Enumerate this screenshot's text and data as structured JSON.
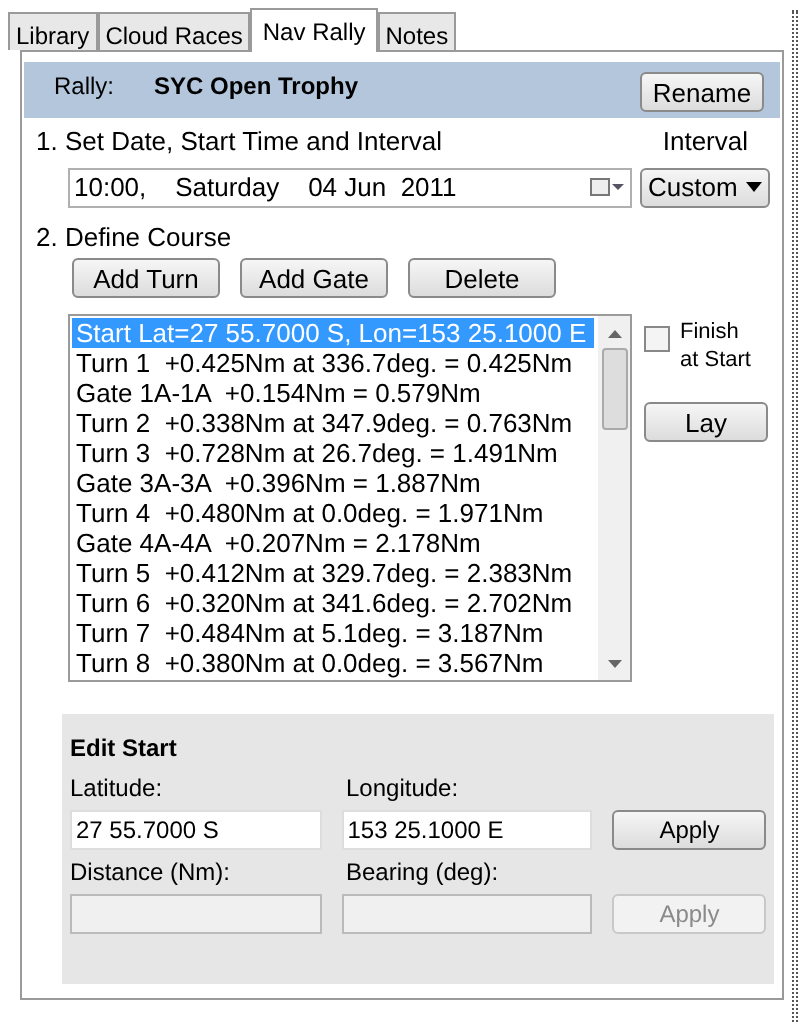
{
  "tabs": [
    {
      "label": "Library",
      "selected": false
    },
    {
      "label": "Cloud Races",
      "selected": false
    },
    {
      "label": "Nav Rally",
      "selected": true
    },
    {
      "label": "Notes",
      "selected": false
    }
  ],
  "rally": {
    "label": "Rally:",
    "name": "SYC Open Trophy",
    "rename_button": "Rename"
  },
  "step1": {
    "label": "1. Set Date, Start Time and Interval",
    "interval_label": "Interval",
    "datetime": "10:00,    Saturday    04 Jun  2011",
    "interval_value": "Custom"
  },
  "step2": {
    "label": "2. Define Course",
    "buttons": [
      "Add Turn",
      "Add Gate",
      "Delete"
    ]
  },
  "course": [
    {
      "text": "Start Lat=27 55.7000 S, Lon=153 25.1000 E",
      "selected": true
    },
    {
      "text": "Turn 1  +0.425Nm at 336.7deg. = 0.425Nm",
      "selected": false
    },
    {
      "text": "Gate 1A-1A  +0.154Nm = 0.579Nm",
      "selected": false
    },
    {
      "text": "Turn 2  +0.338Nm at 347.9deg. = 0.763Nm",
      "selected": false
    },
    {
      "text": "Turn 3  +0.728Nm at 26.7deg. = 1.491Nm",
      "selected": false
    },
    {
      "text": "Gate 3A-3A  +0.396Nm = 1.887Nm",
      "selected": false
    },
    {
      "text": "Turn 4  +0.480Nm at 0.0deg. = 1.971Nm",
      "selected": false
    },
    {
      "text": "Gate 4A-4A  +0.207Nm = 2.178Nm",
      "selected": false
    },
    {
      "text": "Turn 5  +0.412Nm at 329.7deg. = 2.383Nm",
      "selected": false
    },
    {
      "text": "Turn 6  +0.320Nm at 341.6deg. = 2.702Nm",
      "selected": false
    },
    {
      "text": "Turn 7  +0.484Nm at 5.1deg. = 3.187Nm",
      "selected": false
    },
    {
      "text": "Turn 8  +0.380Nm at 0.0deg. = 3.567Nm",
      "selected": false
    }
  ],
  "finish_at_start": {
    "label": "Finish at Start",
    "checked": false
  },
  "lay_button": "Lay",
  "edit": {
    "title": "Edit Start",
    "rows": [
      {
        "fields": [
          {
            "label": "Latitude:",
            "value": "27 55.7000 S",
            "disabled": false
          },
          {
            "label": "Longitude:",
            "value": "153 25.1000 E",
            "disabled": false
          }
        ],
        "apply": "Apply",
        "disabled": false
      },
      {
        "fields": [
          {
            "label": "Distance (Nm):",
            "disabled": true
          },
          {
            "label": "Bearing (deg):",
            "disabled": true
          }
        ],
        "apply": "Apply",
        "disabled": true
      }
    ]
  }
}
